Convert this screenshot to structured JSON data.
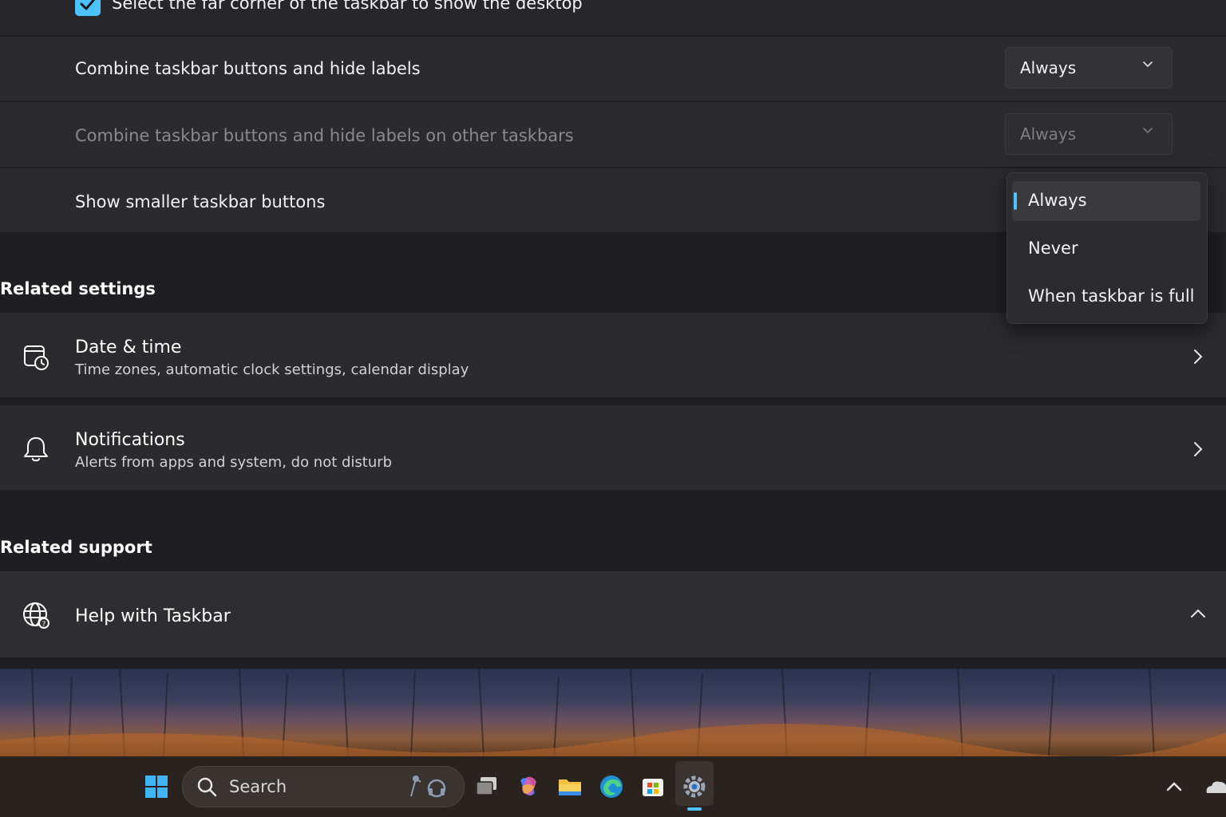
{
  "settings": {
    "show_desktop_checkbox": {
      "label": "Select the far corner of the taskbar to show the desktop",
      "checked": true
    },
    "combine_buttons": {
      "label": "Combine taskbar buttons and hide labels",
      "value": "Always"
    },
    "combine_other": {
      "label": "Combine taskbar buttons and hide labels on other taskbars",
      "value": "Always"
    },
    "smaller_buttons": {
      "label": "Show smaller taskbar buttons"
    }
  },
  "dropdown_menu": {
    "options": [
      "Always",
      "Never",
      "When taskbar is full"
    ],
    "selected": "Always"
  },
  "related_settings": {
    "heading": "Related settings",
    "items": [
      {
        "title": "Date & time",
        "subtitle": "Time zones, automatic clock settings, calendar display",
        "icon": "calendar-clock-icon"
      },
      {
        "title": "Notifications",
        "subtitle": "Alerts from apps and system, do not disturb",
        "icon": "bell-icon"
      }
    ]
  },
  "related_support": {
    "heading": "Related support",
    "items": [
      {
        "title": "Help with Taskbar",
        "icon": "globe-icon",
        "expanded": true
      }
    ]
  },
  "taskbar": {
    "search_placeholder": "Search",
    "apps": [
      "windows-start-icon",
      "task-view-icon",
      "copilot-icon",
      "file-explorer-icon",
      "edge-icon",
      "store-icon",
      "settings-icon"
    ],
    "active_app": "settings-icon"
  },
  "colors": {
    "accent": "#4cc2ff",
    "background": "#1f1e22",
    "card": "#2b2a2e"
  }
}
